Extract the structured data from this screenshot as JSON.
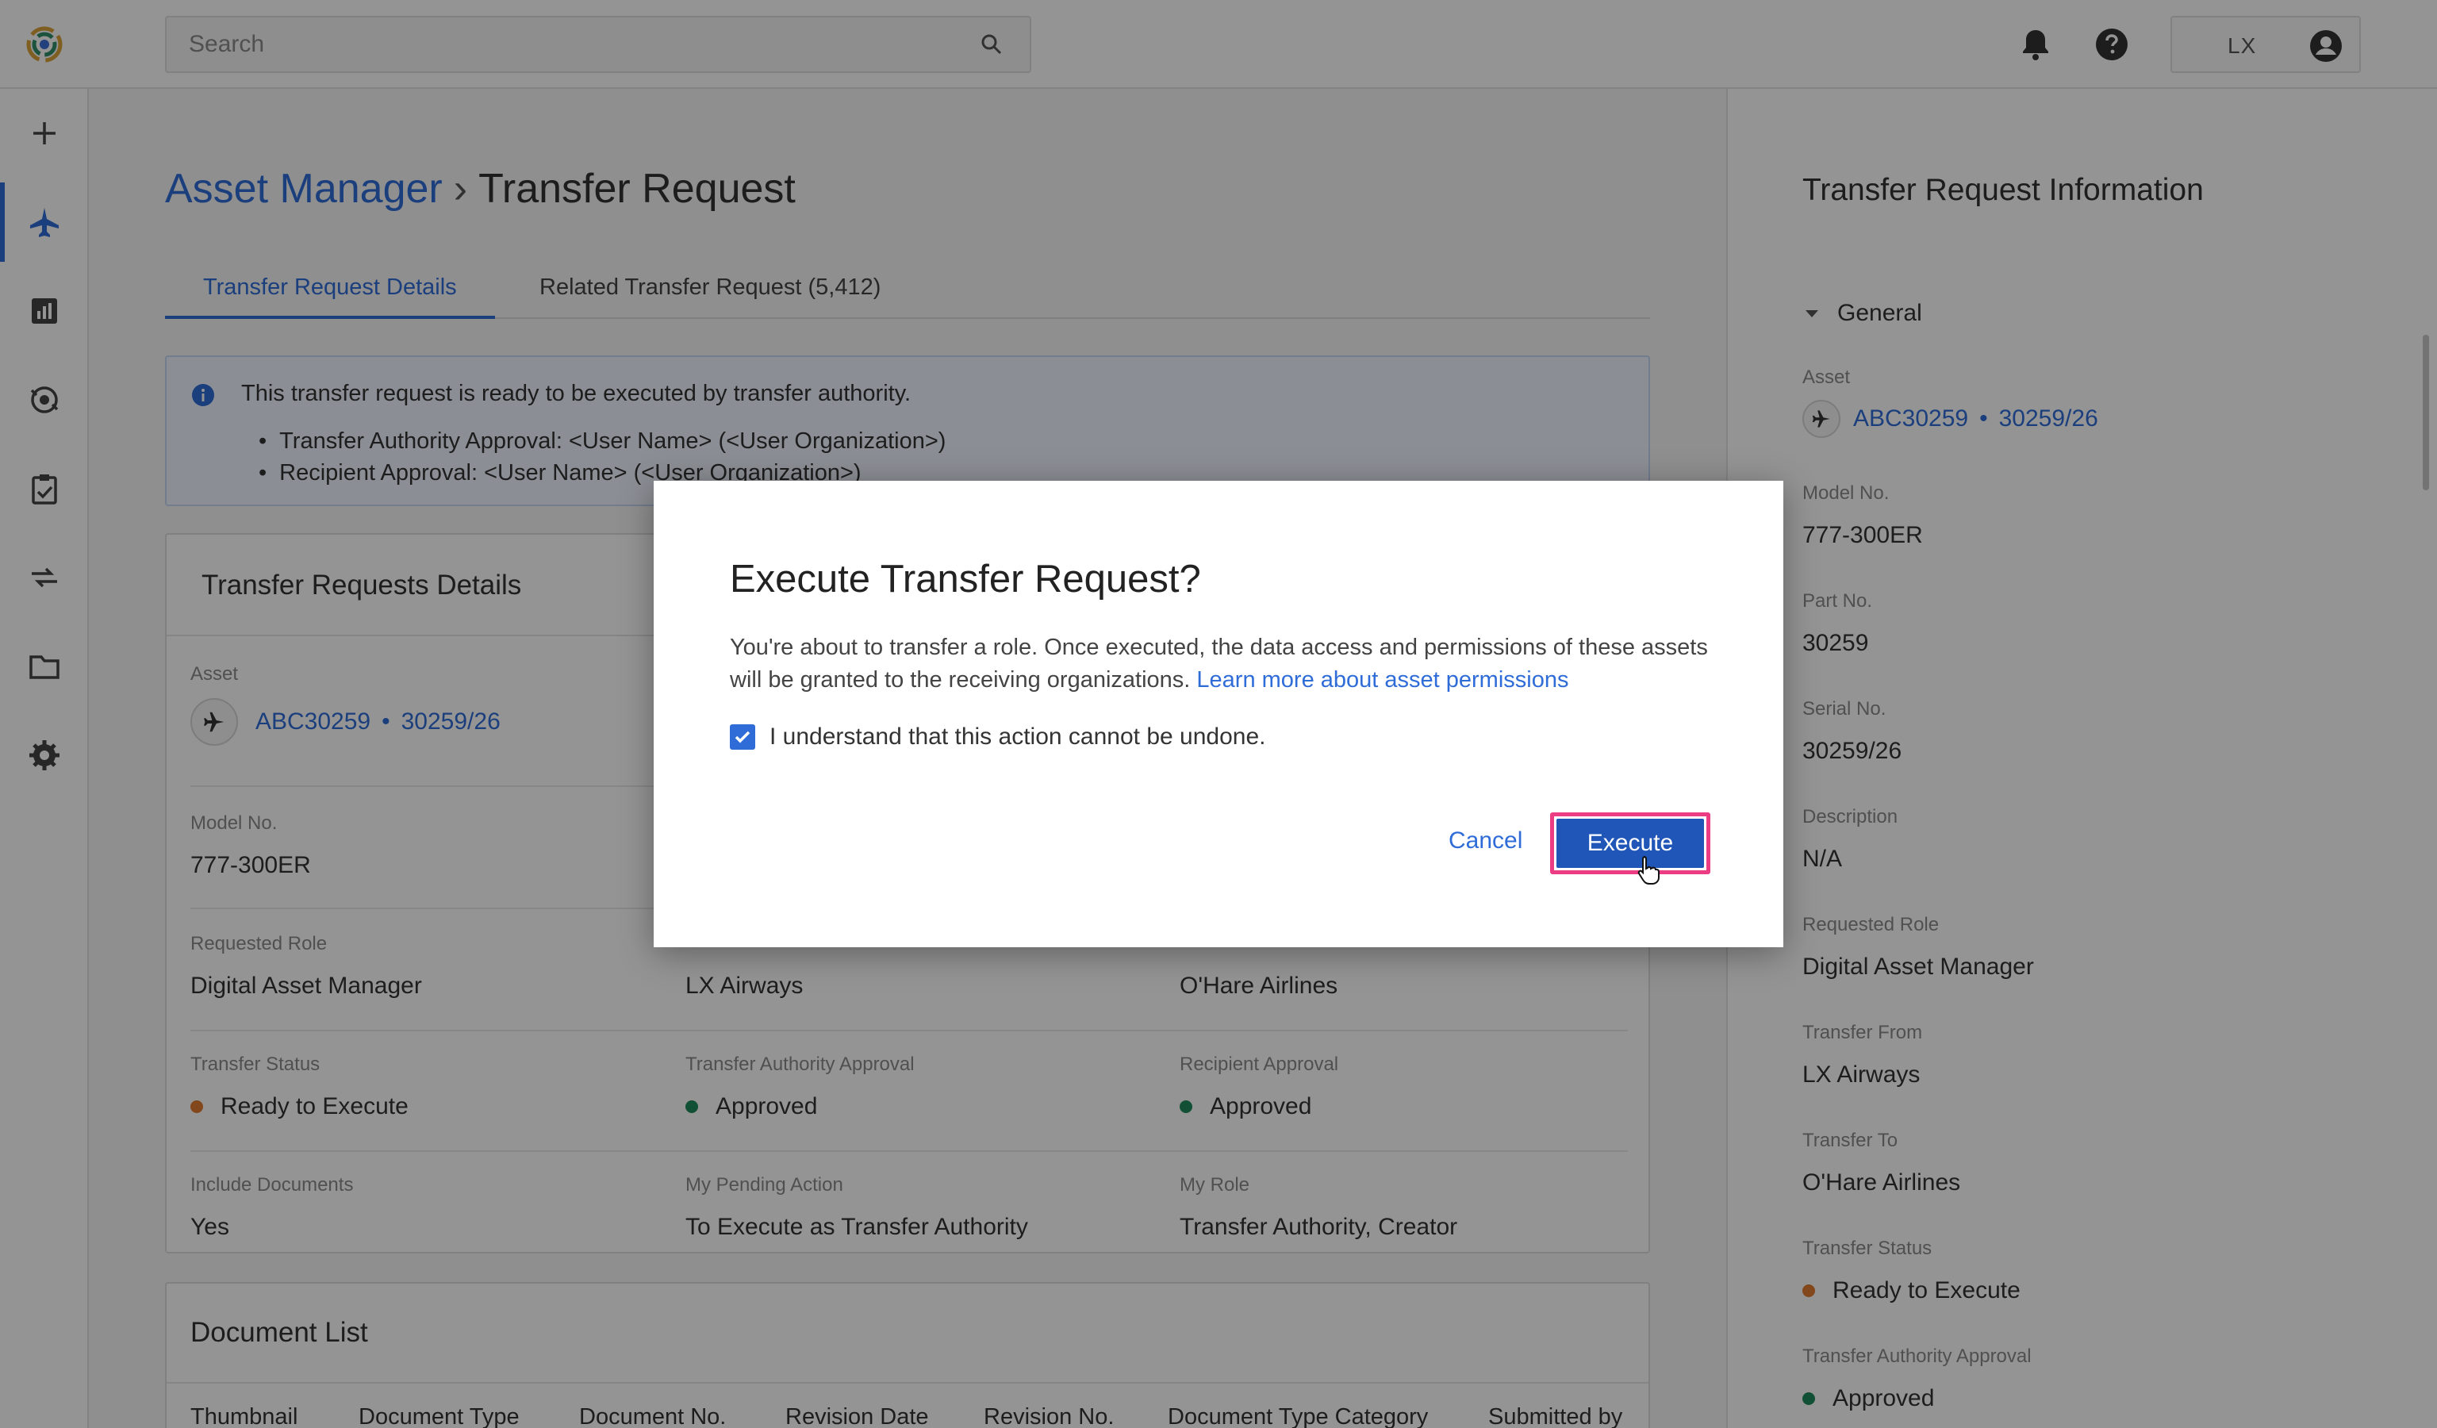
{
  "search": {
    "placeholder": "Search"
  },
  "header": {
    "user_initials": "LX"
  },
  "breadcrumb": {
    "parent": "Asset Manager",
    "separator": "›",
    "current": "Transfer Request"
  },
  "tabs": [
    {
      "label": "Transfer Request Details",
      "active": true
    },
    {
      "label": "Related Transfer Request (5,412)",
      "active": false
    }
  ],
  "banner": {
    "message": "This transfer request is ready to be executed by transfer authority.",
    "items": [
      "Transfer Authority Approval: <User Name> (<User Organization>)",
      "Recipient Approval: <User Name> (<User Organization>)"
    ]
  },
  "details": {
    "title": "Transfer Requests Details",
    "asset_label": "Asset",
    "asset_id": "ABC30259",
    "asset_bullet": "•",
    "asset_serial": "30259/26",
    "model_label": "Model No.",
    "model_value": "777-300ER",
    "role_label": "Requested Role",
    "role_value": "Digital Asset Manager",
    "from_value": "LX Airways",
    "to_value": "O'Hare Airlines",
    "status_label": "Transfer Status",
    "status_value": "Ready to Execute",
    "authority_label": "Transfer Authority Approval",
    "authority_value": "Approved",
    "recipient_label": "Recipient Approval",
    "recipient_value": "Approved",
    "docs_label": "Include Documents",
    "docs_value": "Yes",
    "pending_label": "My Pending Action",
    "pending_value": "To Execute as Transfer Authority",
    "myrole_label": "My Role",
    "myrole_value": "Transfer Authority, Creator"
  },
  "documents": {
    "title": "Document List",
    "columns": [
      "Thumbnail",
      "Document Type",
      "Document No.",
      "Revision Date",
      "Revision No.",
      "Document Type Category",
      "Submitted by"
    ]
  },
  "panel": {
    "title": "Transfer Request Information",
    "section": "General",
    "asset_label": "Asset",
    "asset_id": "ABC30259",
    "asset_bullet": "•",
    "asset_serial": "30259/26",
    "model_label": "Model No.",
    "model_value": "777-300ER",
    "part_label": "Part No.",
    "part_value": "30259",
    "serial_label": "Serial No.",
    "serial_value": "30259/26",
    "desc_label": "Description",
    "desc_value": "N/A",
    "role_label": "Requested Role",
    "role_value": "Digital Asset Manager",
    "from_label": "Transfer From",
    "from_value": "LX Airways",
    "to_label": "Transfer To",
    "to_value": "O'Hare Airlines",
    "status_label": "Transfer Status",
    "status_value": "Ready to Execute",
    "authority_label": "Transfer Authority Approval",
    "authority_value": "Approved"
  },
  "modal": {
    "title": "Execute Transfer Request?",
    "body": "You're about to transfer a role. Once executed, the data access and permissions of these assets will be granted to the receiving organizations.",
    "link": "Learn more about asset permissions",
    "confirm_label": "I understand that this action cannot be undone.",
    "confirm_checked": true,
    "cancel_label": "Cancel",
    "execute_label": "Execute"
  },
  "colors": {
    "accent": "#2f6cd8",
    "primary_button": "#1f56b8",
    "focus_ring": "#ec3c84",
    "status_ready": "#e07a2e",
    "status_approved": "#1e8a5a"
  },
  "icons": {
    "search": "search-icon",
    "notifications": "bell-icon",
    "help": "help-icon",
    "avatar": "user-avatar-icon",
    "asset": "airplane-icon",
    "info": "info-icon"
  }
}
